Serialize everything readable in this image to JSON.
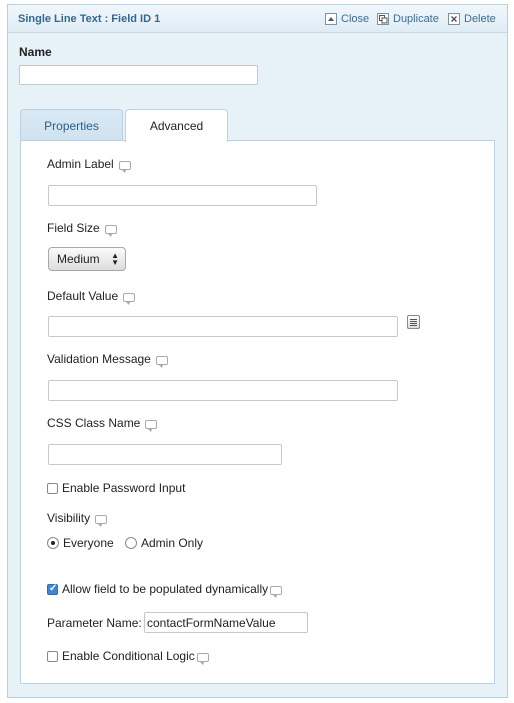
{
  "header": {
    "title": "Single Line Text : Field ID 1",
    "close_label": "Close",
    "duplicate_label": "Duplicate",
    "delete_label": "Delete"
  },
  "name": {
    "label": "Name",
    "value": ""
  },
  "tabs": [
    {
      "label": "Properties",
      "active": false
    },
    {
      "label": "Advanced",
      "active": true
    }
  ],
  "advanced": {
    "admin_label": {
      "label": "Admin Label",
      "value": ""
    },
    "field_size": {
      "label": "Field Size",
      "selected": "Medium"
    },
    "default_value": {
      "label": "Default Value",
      "value": ""
    },
    "validation_message": {
      "label": "Validation Message",
      "value": ""
    },
    "css_class": {
      "label": "CSS Class Name",
      "value": ""
    },
    "enable_password": {
      "label": "Enable Password Input",
      "checked": false
    },
    "visibility": {
      "label": "Visibility",
      "options": [
        {
          "label": "Everyone",
          "selected": true
        },
        {
          "label": "Admin Only",
          "selected": false
        }
      ]
    },
    "populate_dynamic": {
      "label": "Allow field to be populated dynamically",
      "checked": true
    },
    "parameter_name": {
      "label": "Parameter Name:",
      "value": "contactFormNameValue"
    },
    "conditional_logic": {
      "label": "Enable Conditional Logic",
      "checked": false
    }
  }
}
